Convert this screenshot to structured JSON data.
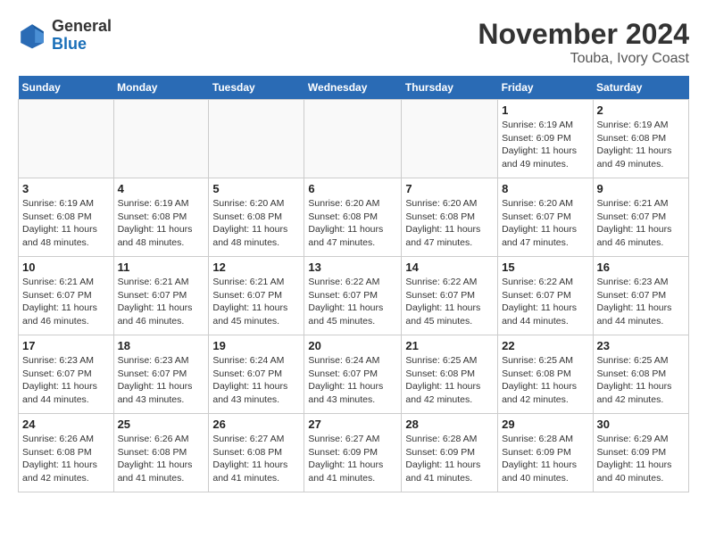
{
  "logo": {
    "general": "General",
    "blue": "Blue"
  },
  "header": {
    "month": "November 2024",
    "location": "Touba, Ivory Coast"
  },
  "days_of_week": [
    "Sunday",
    "Monday",
    "Tuesday",
    "Wednesday",
    "Thursday",
    "Friday",
    "Saturday"
  ],
  "weeks": [
    [
      {
        "day": "",
        "detail": ""
      },
      {
        "day": "",
        "detail": ""
      },
      {
        "day": "",
        "detail": ""
      },
      {
        "day": "",
        "detail": ""
      },
      {
        "day": "",
        "detail": ""
      },
      {
        "day": "1",
        "detail": "Sunrise: 6:19 AM\nSunset: 6:09 PM\nDaylight: 11 hours\nand 49 minutes."
      },
      {
        "day": "2",
        "detail": "Sunrise: 6:19 AM\nSunset: 6:08 PM\nDaylight: 11 hours\nand 49 minutes."
      }
    ],
    [
      {
        "day": "3",
        "detail": "Sunrise: 6:19 AM\nSunset: 6:08 PM\nDaylight: 11 hours\nand 48 minutes."
      },
      {
        "day": "4",
        "detail": "Sunrise: 6:19 AM\nSunset: 6:08 PM\nDaylight: 11 hours\nand 48 minutes."
      },
      {
        "day": "5",
        "detail": "Sunrise: 6:20 AM\nSunset: 6:08 PM\nDaylight: 11 hours\nand 48 minutes."
      },
      {
        "day": "6",
        "detail": "Sunrise: 6:20 AM\nSunset: 6:08 PM\nDaylight: 11 hours\nand 47 minutes."
      },
      {
        "day": "7",
        "detail": "Sunrise: 6:20 AM\nSunset: 6:08 PM\nDaylight: 11 hours\nand 47 minutes."
      },
      {
        "day": "8",
        "detail": "Sunrise: 6:20 AM\nSunset: 6:07 PM\nDaylight: 11 hours\nand 47 minutes."
      },
      {
        "day": "9",
        "detail": "Sunrise: 6:21 AM\nSunset: 6:07 PM\nDaylight: 11 hours\nand 46 minutes."
      }
    ],
    [
      {
        "day": "10",
        "detail": "Sunrise: 6:21 AM\nSunset: 6:07 PM\nDaylight: 11 hours\nand 46 minutes."
      },
      {
        "day": "11",
        "detail": "Sunrise: 6:21 AM\nSunset: 6:07 PM\nDaylight: 11 hours\nand 46 minutes."
      },
      {
        "day": "12",
        "detail": "Sunrise: 6:21 AM\nSunset: 6:07 PM\nDaylight: 11 hours\nand 45 minutes."
      },
      {
        "day": "13",
        "detail": "Sunrise: 6:22 AM\nSunset: 6:07 PM\nDaylight: 11 hours\nand 45 minutes."
      },
      {
        "day": "14",
        "detail": "Sunrise: 6:22 AM\nSunset: 6:07 PM\nDaylight: 11 hours\nand 45 minutes."
      },
      {
        "day": "15",
        "detail": "Sunrise: 6:22 AM\nSunset: 6:07 PM\nDaylight: 11 hours\nand 44 minutes."
      },
      {
        "day": "16",
        "detail": "Sunrise: 6:23 AM\nSunset: 6:07 PM\nDaylight: 11 hours\nand 44 minutes."
      }
    ],
    [
      {
        "day": "17",
        "detail": "Sunrise: 6:23 AM\nSunset: 6:07 PM\nDaylight: 11 hours\nand 44 minutes."
      },
      {
        "day": "18",
        "detail": "Sunrise: 6:23 AM\nSunset: 6:07 PM\nDaylight: 11 hours\nand 43 minutes."
      },
      {
        "day": "19",
        "detail": "Sunrise: 6:24 AM\nSunset: 6:07 PM\nDaylight: 11 hours\nand 43 minutes."
      },
      {
        "day": "20",
        "detail": "Sunrise: 6:24 AM\nSunset: 6:07 PM\nDaylight: 11 hours\nand 43 minutes."
      },
      {
        "day": "21",
        "detail": "Sunrise: 6:25 AM\nSunset: 6:08 PM\nDaylight: 11 hours\nand 42 minutes."
      },
      {
        "day": "22",
        "detail": "Sunrise: 6:25 AM\nSunset: 6:08 PM\nDaylight: 11 hours\nand 42 minutes."
      },
      {
        "day": "23",
        "detail": "Sunrise: 6:25 AM\nSunset: 6:08 PM\nDaylight: 11 hours\nand 42 minutes."
      }
    ],
    [
      {
        "day": "24",
        "detail": "Sunrise: 6:26 AM\nSunset: 6:08 PM\nDaylight: 11 hours\nand 42 minutes."
      },
      {
        "day": "25",
        "detail": "Sunrise: 6:26 AM\nSunset: 6:08 PM\nDaylight: 11 hours\nand 41 minutes."
      },
      {
        "day": "26",
        "detail": "Sunrise: 6:27 AM\nSunset: 6:08 PM\nDaylight: 11 hours\nand 41 minutes."
      },
      {
        "day": "27",
        "detail": "Sunrise: 6:27 AM\nSunset: 6:09 PM\nDaylight: 11 hours\nand 41 minutes."
      },
      {
        "day": "28",
        "detail": "Sunrise: 6:28 AM\nSunset: 6:09 PM\nDaylight: 11 hours\nand 41 minutes."
      },
      {
        "day": "29",
        "detail": "Sunrise: 6:28 AM\nSunset: 6:09 PM\nDaylight: 11 hours\nand 40 minutes."
      },
      {
        "day": "30",
        "detail": "Sunrise: 6:29 AM\nSunset: 6:09 PM\nDaylight: 11 hours\nand 40 minutes."
      }
    ]
  ]
}
